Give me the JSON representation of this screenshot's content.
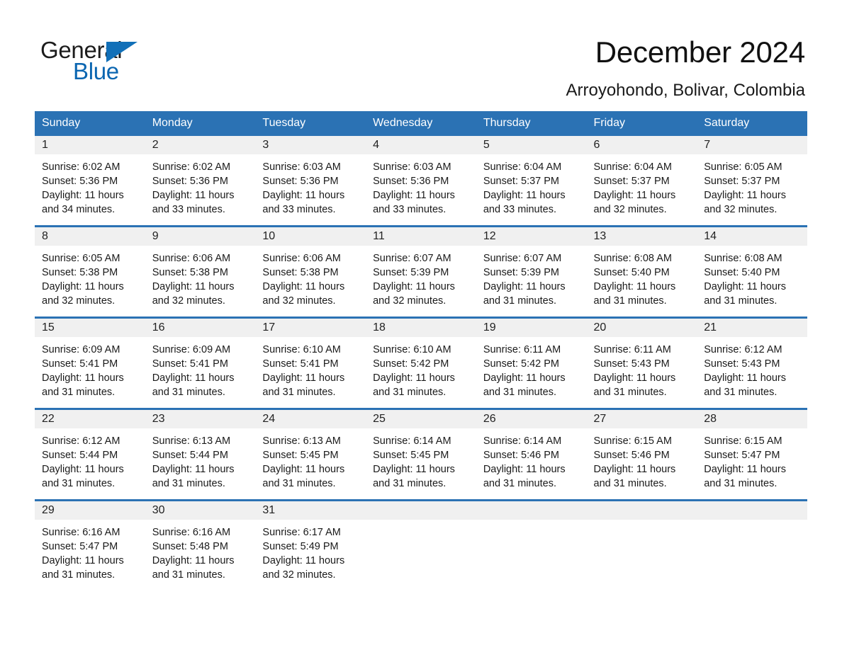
{
  "brand": {
    "name_part1": "General",
    "name_part2": "Blue",
    "accent_color": "#1270b8"
  },
  "header": {
    "month_title": "December 2024",
    "location": "Arroyohondo, Bolivar, Colombia"
  },
  "calendar": {
    "header_color": "#2b72b4",
    "weekdays": [
      "Sunday",
      "Monday",
      "Tuesday",
      "Wednesday",
      "Thursday",
      "Friday",
      "Saturday"
    ],
    "weeks": [
      [
        {
          "day": "1",
          "sunrise": "Sunrise: 6:02 AM",
          "sunset": "Sunset: 5:36 PM",
          "daylight_line1": "Daylight: 11 hours",
          "daylight_line2": "and 34 minutes."
        },
        {
          "day": "2",
          "sunrise": "Sunrise: 6:02 AM",
          "sunset": "Sunset: 5:36 PM",
          "daylight_line1": "Daylight: 11 hours",
          "daylight_line2": "and 33 minutes."
        },
        {
          "day": "3",
          "sunrise": "Sunrise: 6:03 AM",
          "sunset": "Sunset: 5:36 PM",
          "daylight_line1": "Daylight: 11 hours",
          "daylight_line2": "and 33 minutes."
        },
        {
          "day": "4",
          "sunrise": "Sunrise: 6:03 AM",
          "sunset": "Sunset: 5:36 PM",
          "daylight_line1": "Daylight: 11 hours",
          "daylight_line2": "and 33 minutes."
        },
        {
          "day": "5",
          "sunrise": "Sunrise: 6:04 AM",
          "sunset": "Sunset: 5:37 PM",
          "daylight_line1": "Daylight: 11 hours",
          "daylight_line2": "and 33 minutes."
        },
        {
          "day": "6",
          "sunrise": "Sunrise: 6:04 AM",
          "sunset": "Sunset: 5:37 PM",
          "daylight_line1": "Daylight: 11 hours",
          "daylight_line2": "and 32 minutes."
        },
        {
          "day": "7",
          "sunrise": "Sunrise: 6:05 AM",
          "sunset": "Sunset: 5:37 PM",
          "daylight_line1": "Daylight: 11 hours",
          "daylight_line2": "and 32 minutes."
        }
      ],
      [
        {
          "day": "8",
          "sunrise": "Sunrise: 6:05 AM",
          "sunset": "Sunset: 5:38 PM",
          "daylight_line1": "Daylight: 11 hours",
          "daylight_line2": "and 32 minutes."
        },
        {
          "day": "9",
          "sunrise": "Sunrise: 6:06 AM",
          "sunset": "Sunset: 5:38 PM",
          "daylight_line1": "Daylight: 11 hours",
          "daylight_line2": "and 32 minutes."
        },
        {
          "day": "10",
          "sunrise": "Sunrise: 6:06 AM",
          "sunset": "Sunset: 5:38 PM",
          "daylight_line1": "Daylight: 11 hours",
          "daylight_line2": "and 32 minutes."
        },
        {
          "day": "11",
          "sunrise": "Sunrise: 6:07 AM",
          "sunset": "Sunset: 5:39 PM",
          "daylight_line1": "Daylight: 11 hours",
          "daylight_line2": "and 32 minutes."
        },
        {
          "day": "12",
          "sunrise": "Sunrise: 6:07 AM",
          "sunset": "Sunset: 5:39 PM",
          "daylight_line1": "Daylight: 11 hours",
          "daylight_line2": "and 31 minutes."
        },
        {
          "day": "13",
          "sunrise": "Sunrise: 6:08 AM",
          "sunset": "Sunset: 5:40 PM",
          "daylight_line1": "Daylight: 11 hours",
          "daylight_line2": "and 31 minutes."
        },
        {
          "day": "14",
          "sunrise": "Sunrise: 6:08 AM",
          "sunset": "Sunset: 5:40 PM",
          "daylight_line1": "Daylight: 11 hours",
          "daylight_line2": "and 31 minutes."
        }
      ],
      [
        {
          "day": "15",
          "sunrise": "Sunrise: 6:09 AM",
          "sunset": "Sunset: 5:41 PM",
          "daylight_line1": "Daylight: 11 hours",
          "daylight_line2": "and 31 minutes."
        },
        {
          "day": "16",
          "sunrise": "Sunrise: 6:09 AM",
          "sunset": "Sunset: 5:41 PM",
          "daylight_line1": "Daylight: 11 hours",
          "daylight_line2": "and 31 minutes."
        },
        {
          "day": "17",
          "sunrise": "Sunrise: 6:10 AM",
          "sunset": "Sunset: 5:41 PM",
          "daylight_line1": "Daylight: 11 hours",
          "daylight_line2": "and 31 minutes."
        },
        {
          "day": "18",
          "sunrise": "Sunrise: 6:10 AM",
          "sunset": "Sunset: 5:42 PM",
          "daylight_line1": "Daylight: 11 hours",
          "daylight_line2": "and 31 minutes."
        },
        {
          "day": "19",
          "sunrise": "Sunrise: 6:11 AM",
          "sunset": "Sunset: 5:42 PM",
          "daylight_line1": "Daylight: 11 hours",
          "daylight_line2": "and 31 minutes."
        },
        {
          "day": "20",
          "sunrise": "Sunrise: 6:11 AM",
          "sunset": "Sunset: 5:43 PM",
          "daylight_line1": "Daylight: 11 hours",
          "daylight_line2": "and 31 minutes."
        },
        {
          "day": "21",
          "sunrise": "Sunrise: 6:12 AM",
          "sunset": "Sunset: 5:43 PM",
          "daylight_line1": "Daylight: 11 hours",
          "daylight_line2": "and 31 minutes."
        }
      ],
      [
        {
          "day": "22",
          "sunrise": "Sunrise: 6:12 AM",
          "sunset": "Sunset: 5:44 PM",
          "daylight_line1": "Daylight: 11 hours",
          "daylight_line2": "and 31 minutes."
        },
        {
          "day": "23",
          "sunrise": "Sunrise: 6:13 AM",
          "sunset": "Sunset: 5:44 PM",
          "daylight_line1": "Daylight: 11 hours",
          "daylight_line2": "and 31 minutes."
        },
        {
          "day": "24",
          "sunrise": "Sunrise: 6:13 AM",
          "sunset": "Sunset: 5:45 PM",
          "daylight_line1": "Daylight: 11 hours",
          "daylight_line2": "and 31 minutes."
        },
        {
          "day": "25",
          "sunrise": "Sunrise: 6:14 AM",
          "sunset": "Sunset: 5:45 PM",
          "daylight_line1": "Daylight: 11 hours",
          "daylight_line2": "and 31 minutes."
        },
        {
          "day": "26",
          "sunrise": "Sunrise: 6:14 AM",
          "sunset": "Sunset: 5:46 PM",
          "daylight_line1": "Daylight: 11 hours",
          "daylight_line2": "and 31 minutes."
        },
        {
          "day": "27",
          "sunrise": "Sunrise: 6:15 AM",
          "sunset": "Sunset: 5:46 PM",
          "daylight_line1": "Daylight: 11 hours",
          "daylight_line2": "and 31 minutes."
        },
        {
          "day": "28",
          "sunrise": "Sunrise: 6:15 AM",
          "sunset": "Sunset: 5:47 PM",
          "daylight_line1": "Daylight: 11 hours",
          "daylight_line2": "and 31 minutes."
        }
      ],
      [
        {
          "day": "29",
          "sunrise": "Sunrise: 6:16 AM",
          "sunset": "Sunset: 5:47 PM",
          "daylight_line1": "Daylight: 11 hours",
          "daylight_line2": "and 31 minutes."
        },
        {
          "day": "30",
          "sunrise": "Sunrise: 6:16 AM",
          "sunset": "Sunset: 5:48 PM",
          "daylight_line1": "Daylight: 11 hours",
          "daylight_line2": "and 31 minutes."
        },
        {
          "day": "31",
          "sunrise": "Sunrise: 6:17 AM",
          "sunset": "Sunset: 5:49 PM",
          "daylight_line1": "Daylight: 11 hours",
          "daylight_line2": "and 32 minutes."
        },
        {
          "day": "",
          "sunrise": "",
          "sunset": "",
          "daylight_line1": "",
          "daylight_line2": ""
        },
        {
          "day": "",
          "sunrise": "",
          "sunset": "",
          "daylight_line1": "",
          "daylight_line2": ""
        },
        {
          "day": "",
          "sunrise": "",
          "sunset": "",
          "daylight_line1": "",
          "daylight_line2": ""
        },
        {
          "day": "",
          "sunrise": "",
          "sunset": "",
          "daylight_line1": "",
          "daylight_line2": ""
        }
      ]
    ]
  }
}
